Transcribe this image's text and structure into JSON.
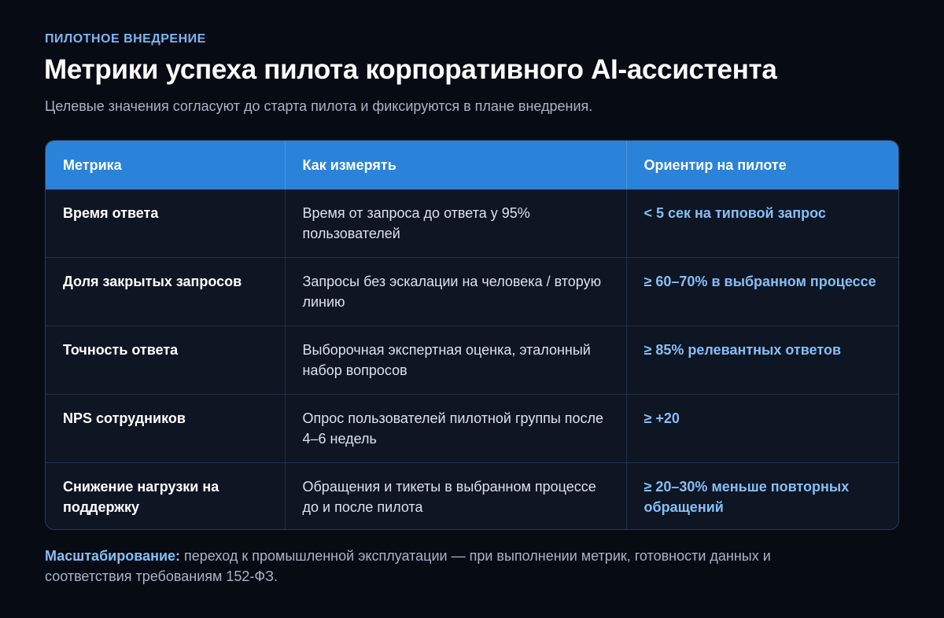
{
  "header": {
    "eyebrow": "ПИЛОТНОЕ ВНЕДРЕНИЕ",
    "title": "Метрики успеха пилота корпоративного AI-ассистента",
    "subtitle": "Целевые значения согласуют до старта пилота и фиксируются в плане внедрения."
  },
  "table": {
    "columns": [
      "Метрика",
      "Как измерять",
      "Ориентир на пилоте"
    ],
    "rows": [
      {
        "metric": "Время ответа",
        "measure": "Время от запроса до ответа у 95% пользователей",
        "target": "< 5 сек на типовой запрос"
      },
      {
        "metric": "Доля закрытых запросов",
        "measure": "Запросы без эскалации на человека / вторую линию",
        "target": "≥ 60–70% в выбранном процессе"
      },
      {
        "metric": "Точность ответа",
        "measure": "Выборочная экспертная оценка, эталонный набор вопросов",
        "target": "≥ 85% релевантных ответов"
      },
      {
        "metric": "NPS сотрудников",
        "measure": "Опрос пользователей пилотной группы после 4–6 недель",
        "target": "≥ +20"
      },
      {
        "metric": "Снижение нагрузки на поддержку",
        "measure": "Обращения и тикеты в выбранном процессе до и после пилота",
        "target": "≥ 20–30% меньше повторных обращений"
      }
    ]
  },
  "footer": {
    "label": "Масштабирование:",
    "text": " переход к промышленной эксплуатации — при выполнении метрик, готовности данных и соответствия требованиям 152-ФЗ."
  },
  "colors": {
    "background": "#070b14",
    "header_row": "#2a83d8",
    "accent_text": "#86bff5"
  }
}
